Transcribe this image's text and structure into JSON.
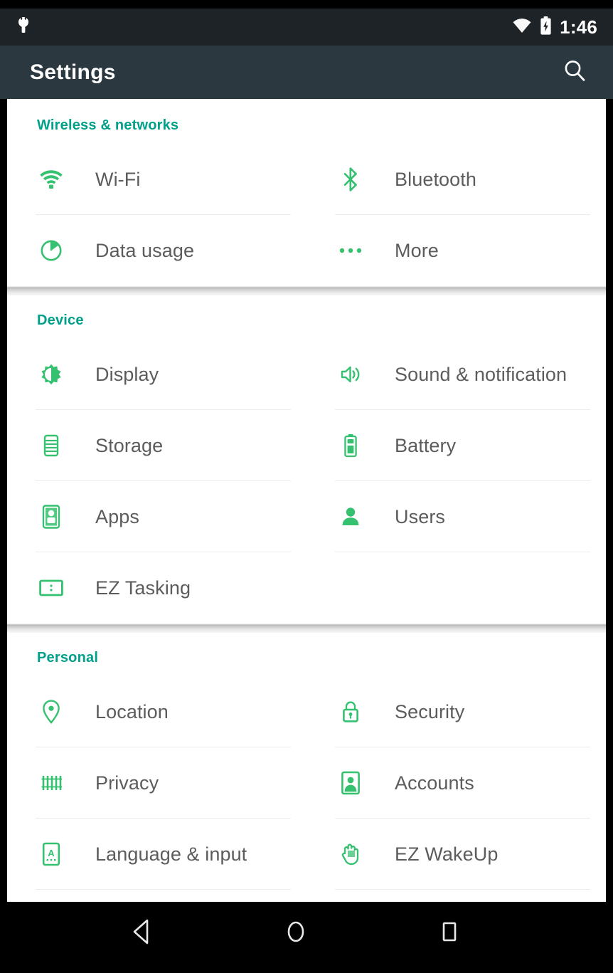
{
  "statusbar": {
    "time": "1:46",
    "left_icons": [
      {
        "name": "usb-debugging-icon"
      }
    ],
    "right_icons": [
      {
        "name": "wifi-signal-icon"
      },
      {
        "name": "battery-charging-icon"
      }
    ]
  },
  "actionbar": {
    "title": "Settings",
    "search_label": "Search",
    "search_icon": "search-icon"
  },
  "colors": {
    "accent_green": "#35c16f",
    "section_header_teal": "#00a08a",
    "status_bar": "#1d2327",
    "action_bar": "#2c383f",
    "label_text": "#5c5c5c"
  },
  "sections": [
    {
      "id": "wireless-networks",
      "header": "Wireless & networks",
      "items": [
        {
          "label": "Wi-Fi",
          "icon": "wifi-icon",
          "name": "settings-item-wifi"
        },
        {
          "label": "Bluetooth",
          "icon": "bluetooth-icon",
          "name": "settings-item-bluetooth"
        },
        {
          "label": "Data usage",
          "icon": "data-usage-icon",
          "name": "settings-item-data-usage"
        },
        {
          "label": "More",
          "icon": "more-dots-icon",
          "name": "settings-item-more"
        }
      ]
    },
    {
      "id": "device",
      "header": "Device",
      "items": [
        {
          "label": "Display",
          "icon": "brightness-icon",
          "name": "settings-item-display"
        },
        {
          "label": "Sound & notification",
          "icon": "volume-icon",
          "name": "settings-item-sound-notification"
        },
        {
          "label": "Storage",
          "icon": "storage-disc-icon",
          "name": "settings-item-storage"
        },
        {
          "label": "Battery",
          "icon": "battery-icon",
          "name": "settings-item-battery"
        },
        {
          "label": "Apps",
          "icon": "apps-android-icon",
          "name": "settings-item-apps"
        },
        {
          "label": "Users",
          "icon": "person-icon",
          "name": "settings-item-users"
        },
        {
          "label": "EZ Tasking",
          "icon": "split-screen-icon",
          "name": "settings-item-ez-tasking"
        }
      ]
    },
    {
      "id": "personal",
      "header": "Personal",
      "items": [
        {
          "label": "Location",
          "icon": "location-pin-icon",
          "name": "settings-item-location"
        },
        {
          "label": "Security",
          "icon": "lock-icon",
          "name": "settings-item-security"
        },
        {
          "label": "Privacy",
          "icon": "fingerprint-bars-icon",
          "name": "settings-item-privacy"
        },
        {
          "label": "Accounts",
          "icon": "account-card-icon",
          "name": "settings-item-accounts"
        },
        {
          "label": "Language & input",
          "icon": "keyboard-language-icon",
          "name": "settings-item-language-input"
        },
        {
          "label": "EZ WakeUp",
          "icon": "hand-tap-icon",
          "name": "settings-item-ez-wakeup"
        }
      ]
    }
  ],
  "navbar": {
    "back_label": "Back",
    "home_label": "Home",
    "recents_label": "Recents",
    "icons": [
      "back-triangle-icon",
      "home-circle-icon",
      "recents-square-icon"
    ]
  }
}
